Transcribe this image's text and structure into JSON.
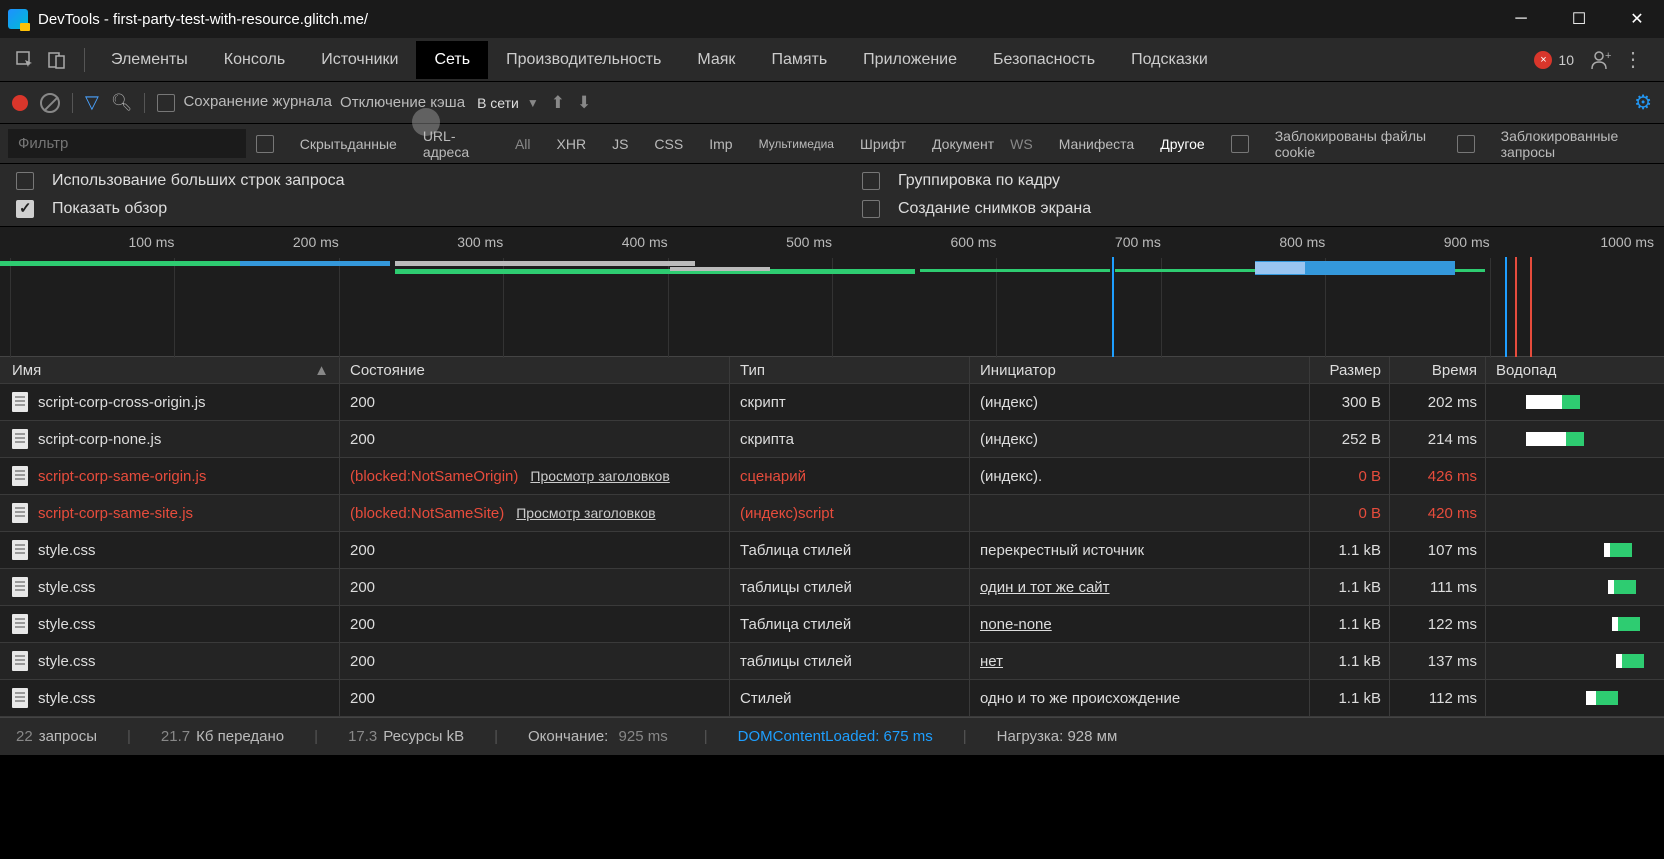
{
  "window": {
    "title": "DevTools - first-party-test-with-resource.glitch.me/"
  },
  "tabs": {
    "items": [
      "Элементы",
      "Консоль",
      "Источники",
      "Сеть",
      "Производительность",
      "Маяк",
      "Память",
      "Приложение",
      "Безопасность",
      "Подсказки"
    ],
    "active": 3,
    "errors": "10",
    "err_x": "×"
  },
  "toolbar": {
    "preserve": "Сохранение журнала",
    "disable_cache": "Отключение кэша",
    "online": "В сети",
    "tri": "▼"
  },
  "filters": {
    "placeholder": "Фильтр",
    "hide_data": "Скрытьданные",
    "url": "URL-адреса",
    "all": "All",
    "xhr": "XHR",
    "js": "JS",
    "css": "CSS",
    "imp": "Imp",
    "media": "Мультимедиа",
    "font": "Шрифт",
    "doc": "Документ",
    "ws": "WS",
    "manifest": "Манифеста",
    "other": "Другое",
    "blocked_cookies": "Заблокированы файлы cookie",
    "blocked_req": "Заблокированные запросы"
  },
  "options": {
    "large_rows": "Использование больших строк запроса",
    "show_overview": "Показать обзор",
    "group_frame": "Группировка по кадру",
    "screenshots": "Создание снимков экрана"
  },
  "timeline": {
    "ticks": [
      "100 ms",
      "200 ms",
      "300 ms",
      "400 ms",
      "500 ms",
      "600 ms",
      "700 ms",
      "800 ms",
      "900 ms",
      "1000 ms"
    ]
  },
  "columns": {
    "name": "Имя",
    "status": "Состояние",
    "type": "Тип",
    "initiator": "Инициатор",
    "size": "Размер",
    "time": "Время",
    "waterfall": "Водопад"
  },
  "rows": [
    {
      "name": "script-corp-cross-origin.js",
      "status": "200",
      "type": "скрипт",
      "init": "(индекс)",
      "size": "300 B",
      "time": "202 ms",
      "red": false,
      "ul": false,
      "wf": {
        "l": 40,
        "w1": 36,
        "w2": 18
      }
    },
    {
      "name": "script-corp-none.js",
      "status": "200",
      "type": "скрипта",
      "init": "(индекс)",
      "size": "252 B",
      "time": "214 ms",
      "red": false,
      "ul": false,
      "wf": {
        "l": 40,
        "w1": 40,
        "w2": 18
      }
    },
    {
      "name": "script-corp-same-origin.js",
      "status": "(blocked:NotSameOrigin)",
      "status2": "Просмотр заголовков",
      "type": "сценарий",
      "init": "(индекс).",
      "size": "0 B",
      "time": "426 ms",
      "red": true,
      "ul": false
    },
    {
      "name": "script-corp-same-site.js",
      "status": "(blocked:NotSameSite)",
      "status2": "Просмотр заголовков",
      "type": "(индекс)script",
      "init": "",
      "size": "0 B",
      "time": "420 ms",
      "red": true,
      "ul": false
    },
    {
      "name": "style.css",
      "status": "200",
      "type": "Таблица стилей",
      "init": "перекрестный источник",
      "size": "1.1 kB",
      "time": "107 ms",
      "red": false,
      "ul": false,
      "wf": {
        "l": 118,
        "w1": 6,
        "w2": 22
      }
    },
    {
      "name": "style.css",
      "status": "200",
      "type": "таблицы стилей",
      "init": "один и тот же сайт",
      "size": "1.1 kB",
      "time": "111 ms",
      "red": false,
      "ul": true,
      "wf": {
        "l": 122,
        "w1": 6,
        "w2": 22
      }
    },
    {
      "name": "style.css",
      "status": "200",
      "type": "Таблица стилей",
      "init": "none-none",
      "size": "1.1 kB",
      "time": "122 ms",
      "red": false,
      "ul": true,
      "wf": {
        "l": 126,
        "w1": 6,
        "w2": 22
      }
    },
    {
      "name": "style.css",
      "status": "200",
      "type": "таблицы стилей",
      "init": "нет",
      "size": "1.1 kB",
      "time": "137 ms",
      "red": false,
      "ul": true,
      "wf": {
        "l": 130,
        "w1": 6,
        "w2": 22
      }
    },
    {
      "name": "style.css",
      "status": "200",
      "type": "Стилей",
      "init": "одно и то же происхождение",
      "size": "1.1 kB",
      "time": "112 ms",
      "red": false,
      "ul": false,
      "wf": {
        "l": 100,
        "w1": 10,
        "w2": 22
      }
    }
  ],
  "status": {
    "req_n": "22",
    "req_t": "запросы",
    "tx_n": "21.7",
    "tx_t": "Кб передано",
    "res_n": "17.3",
    "res_t": "Ресурсы kB",
    "finish": "Окончание:",
    "finish_v": "925 ms",
    "dcl": "DOMContentLoaded: 675 ms",
    "load": "Нагрузка: 928 мм"
  }
}
